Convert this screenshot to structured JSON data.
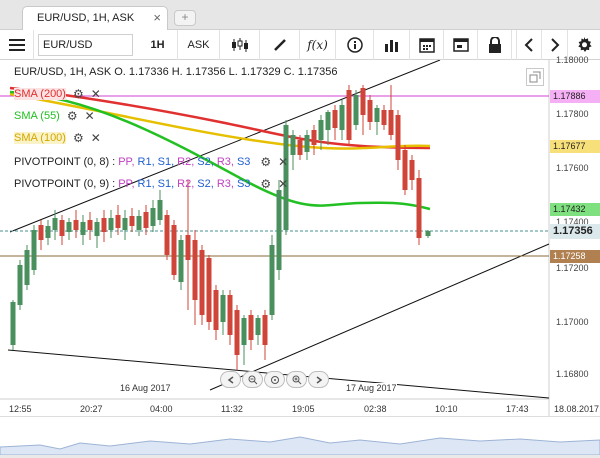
{
  "tab": {
    "title": "EUR/USD, 1H, ASK",
    "close_icon": "×",
    "add_label": "+"
  },
  "toolbar": {
    "symbol": "EUR/USD",
    "timeframe": "1H",
    "price_side": "ASK",
    "fx_label": "f(x)"
  },
  "info": {
    "line": "EUR/USD, 1H, ASK   O. 1.17336 H. 1.17356 L. 1.17329 C. 1.17356"
  },
  "indicators": [
    {
      "label": "SMA (200)",
      "color": "#e03030"
    },
    {
      "label": "SMA (55)",
      "color": "#22c022"
    },
    {
      "label": "SMA (100)",
      "color": "#e6c000"
    }
  ],
  "pivots": [
    {
      "label": "PIVOTPOINT (0, 8)",
      "parts": [
        ":",
        "PP,",
        "R1,",
        "S1,",
        "R2,",
        "S2,",
        "R3,",
        "S3"
      ]
    },
    {
      "label": "PIVOTPOINT (0, 9)",
      "parts": [
        ":",
        "PP,",
        "R1,",
        "S1,",
        "R2,",
        "S2,",
        "R3,",
        "S3"
      ]
    }
  ],
  "pivot_part_colors": [
    "#222",
    "#c040c0",
    "#2060d0",
    "#2060d0",
    "#c040c0",
    "#2060d0",
    "#c040c0",
    "#2060d0"
  ],
  "y_axis": {
    "ticks": [
      "1.18000",
      "1.17800",
      "1.17600",
      "1.17400",
      "1.17200",
      "1.17000",
      "1.16800"
    ],
    "tags": [
      {
        "value": "1.17886",
        "bg": "#f5b0f5",
        "bold": false
      },
      {
        "value": "1.17677",
        "bg": "#f7e07a",
        "bold": false
      },
      {
        "value": "1.17432",
        "bg": "#7ee07e",
        "bold": false
      },
      {
        "value": "1.17356",
        "bg": "#dbe8ec",
        "bold": true
      },
      {
        "value": "1.17258",
        "bg": "#b08050",
        "bold": false
      }
    ]
  },
  "x_axis": {
    "ticks": [
      "12:55",
      "20:27",
      "04:00",
      "11:32",
      "19:05",
      "02:38",
      "10:10",
      "17:43",
      "18.08.2017"
    ],
    "date_labels": [
      "16 Aug 2017",
      "17 Aug 2017"
    ]
  },
  "colors": {
    "bull": "#4a8f5e",
    "bear": "#d0453a",
    "sma200": "#e03030",
    "sma55": "#22c022",
    "sma100": "#e6c000",
    "magenta_line": "#d040d0",
    "brown_line": "#8a6a3a"
  }
}
